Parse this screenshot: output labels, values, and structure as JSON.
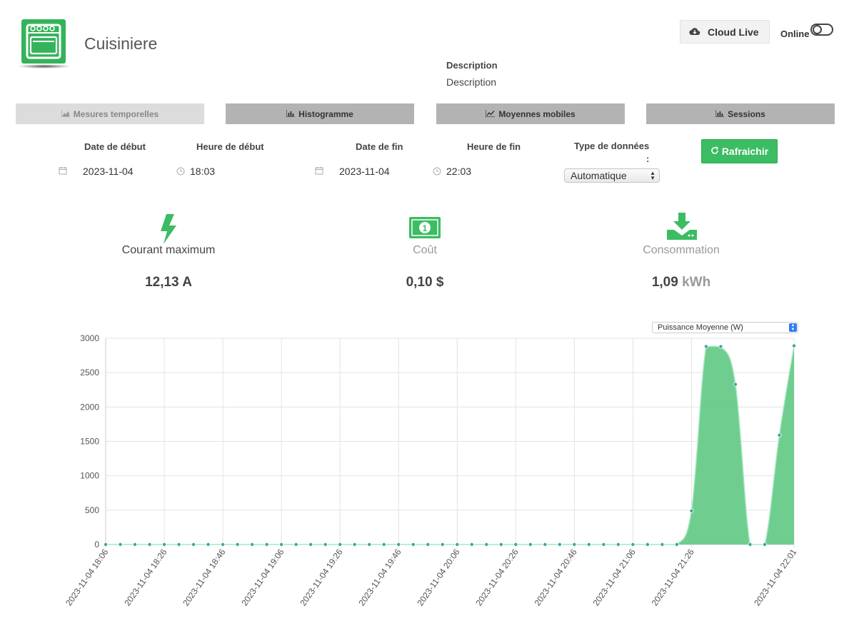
{
  "device": {
    "name": "Cuisiniere",
    "icon": "oven-icon"
  },
  "header": {
    "cloud_label": "Cloud Live",
    "online_label": "Online"
  },
  "description": {
    "heading": "Description",
    "value": "Description"
  },
  "tabs": [
    {
      "label": "Mesures temporelles",
      "icon": "area-chart-icon",
      "active": true
    },
    {
      "label": "Histogramme",
      "icon": "bar-chart-icon",
      "active": false
    },
    {
      "label": "Moyennes mobiles",
      "icon": "line-chart-icon",
      "active": false
    },
    {
      "label": "Sessions",
      "icon": "bar-chart-icon",
      "active": false
    }
  ],
  "filters": {
    "start_date_label": "Date de début",
    "start_time_label": "Heure de début",
    "end_date_label": "Date de fin",
    "end_time_label": "Heure de fin",
    "type_label": "Type de données",
    "type_colon": ":",
    "start_date": "2023-11-04",
    "start_time": "18:03",
    "end_date": "2023-11-04",
    "end_time": "22:03",
    "type_value": "Automatique",
    "refresh_label": "Rafraichir"
  },
  "metrics": {
    "current": {
      "title": "Courant maximum",
      "value": "12,13 A",
      "icon": "lightning-icon"
    },
    "cost": {
      "title": "Coût",
      "value": "0,10 $",
      "icon": "money-icon"
    },
    "consumption": {
      "title": "Consommation",
      "value": "1,09",
      "unit": "kWh",
      "icon": "download-icon"
    }
  },
  "colors": {
    "accent": "#3cbc63",
    "fill": "#5fc983",
    "line": "#a8e6c0",
    "point": "#3aa7a0"
  },
  "chart_select": "Puissance Moyenne (W)",
  "chart_data": {
    "type": "area",
    "ylim": [
      0,
      3000
    ],
    "yticks": [
      0,
      500,
      1000,
      1500,
      2000,
      2500,
      3000
    ],
    "xtick_labels": [
      "2023-11-04 18:06",
      "2023-11-04 18:26",
      "2023-11-04 18:46",
      "2023-11-04 19:06",
      "2023-11-04 19:26",
      "2023-11-04 19:46",
      "2023-11-04 20:06",
      "2023-11-04 20:26",
      "2023-11-04 20:46",
      "2023-11-04 21:06",
      "2023-11-04 21:26",
      "2023-11-04 22:01"
    ],
    "x_minutes_from_start": [
      0,
      5,
      10,
      15,
      20,
      25,
      30,
      35,
      40,
      45,
      50,
      55,
      60,
      65,
      70,
      75,
      80,
      85,
      90,
      95,
      100,
      105,
      110,
      115,
      120,
      125,
      130,
      135,
      140,
      145,
      150,
      155,
      160,
      165,
      170,
      175,
      180,
      185,
      190,
      195,
      200,
      205,
      210,
      215,
      220,
      225,
      230,
      235
    ],
    "values": [
      0,
      0,
      0,
      0,
      0,
      0,
      0,
      0,
      0,
      0,
      0,
      0,
      0,
      0,
      0,
      0,
      0,
      0,
      0,
      0,
      0,
      0,
      0,
      0,
      0,
      0,
      0,
      0,
      0,
      0,
      0,
      0,
      0,
      0,
      0,
      0,
      0,
      0,
      0,
      0,
      490,
      2880,
      2880,
      2330,
      0,
      0,
      1590,
      2890
    ],
    "grid": true
  }
}
